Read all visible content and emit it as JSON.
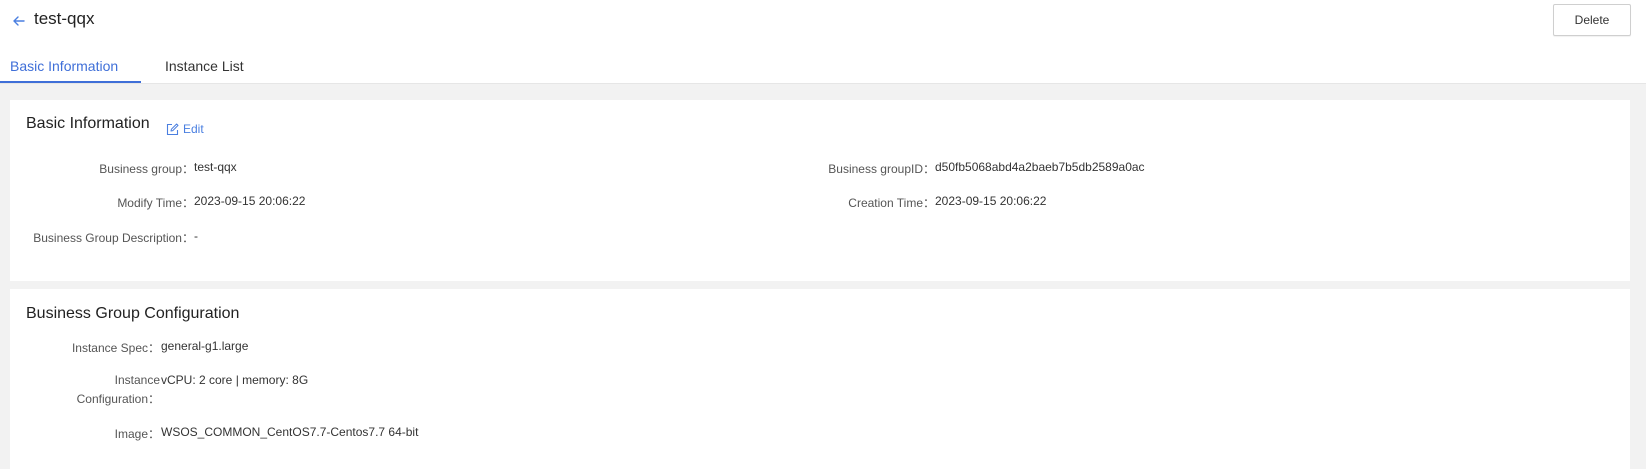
{
  "header": {
    "title": "test-qqx",
    "delete_label": "Delete",
    "tabs": [
      {
        "label": "Basic Information",
        "active": true
      },
      {
        "label": "Instance List",
        "active": false
      }
    ]
  },
  "basic_info": {
    "title": "Basic Information",
    "edit_label": "Edit",
    "fields": {
      "business_group": {
        "label": "Business group：",
        "value": "test-qqx"
      },
      "business_group_id": {
        "label": "Business groupID：",
        "value": "d50fb5068abd4a2baeb7b5db2589a0ac"
      },
      "modify_time": {
        "label": "Modify Time：",
        "value": "2023-09-15 20:06:22"
      },
      "creation_time": {
        "label": "Creation Time：",
        "value": "2023-09-15 20:06:22"
      },
      "description": {
        "label": "Business Group Description：",
        "value": "-"
      }
    }
  },
  "config": {
    "title": "Business Group Configuration",
    "fields": {
      "instance_spec": {
        "label": "Instance Spec：",
        "value": "general-g1.large"
      },
      "instance_config": {
        "label_line1": "Instance",
        "label_line2": "Configuration：",
        "value": "vCPU: 2 core | memory: 8G"
      },
      "image": {
        "label": "Image：",
        "value": "WSOS_COMMON_CentOS7.7-Centos7.7 64-bit"
      }
    }
  },
  "colors": {
    "accent": "#3f6fd8",
    "link": "#4a7fe0",
    "background": "#f2f2f2"
  },
  "icons": {
    "back": "arrow-left-icon",
    "edit": "edit-icon"
  }
}
